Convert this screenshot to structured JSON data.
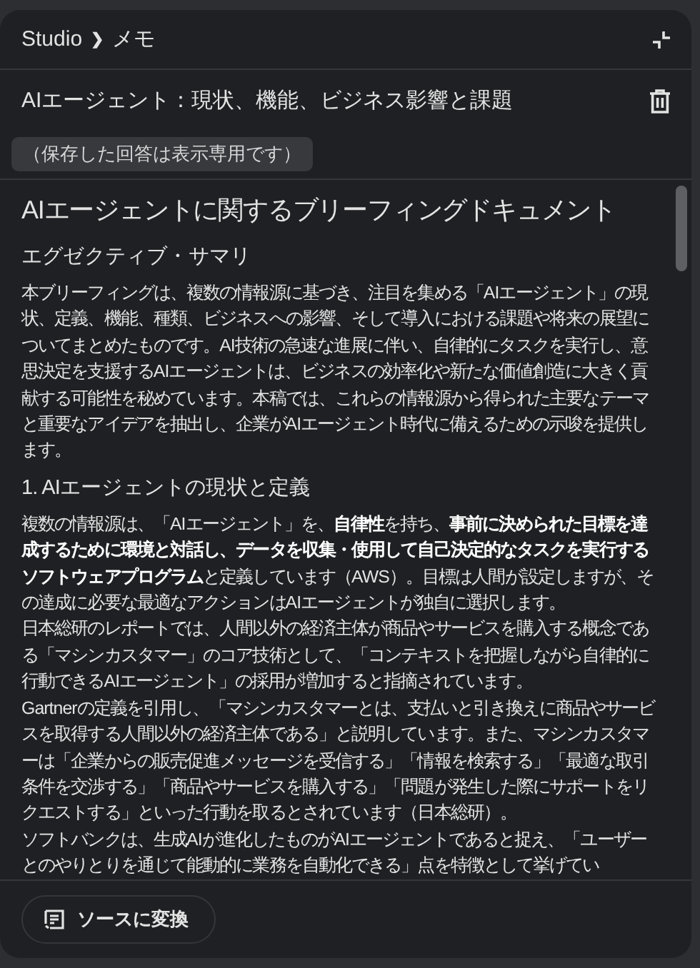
{
  "breadcrumb": {
    "root": "Studio",
    "separator": "❯",
    "current": "メモ"
  },
  "note": {
    "title": "AIエージェント：現状、機能、ビジネス影響と課題",
    "badge": "（保存した回答は表示専用です）"
  },
  "document": {
    "heading": "AIエージェントに関するブリーフィングドキュメント",
    "sections": [
      {
        "title": "エグゼクティブ・サマリ",
        "paragraphs": [
          "本ブリーフィングは、複数の情報源に基づき、注目を集める「AIエージェント」の現状、定義、機能、種類、ビジネスへの影響、そして導入における課題や将来の展望についてまとめたものです。AI技術の急速な進展に伴い、自律的にタスクを実行し、意思決定を支援するAIエージェントは、ビジネスの効率化や新たな価値創造に大きく貢献する可能性を秘めています。本稿では、これらの情報源から得られた主要なテーマと重要なアイデアを抽出し、企業がAIエージェント時代に備えるための示唆を提供します。"
        ]
      },
      {
        "title": "1. AIエージェントの現状と定義",
        "paragraphs": [
          "複数の情報源は、「AIエージェント」を、**自律性**を持ち、**事前に決められた目標を達成するために環境と対話し、データを収集・使用して自己決定的なタスクを実行するソフトウェアプログラム**と定義しています（AWS）。目標は人間が設定しますが、その達成に必要な最適なアクションはAIエージェントが独自に選択します。",
          "日本総研のレポートでは、人間以外の経済主体が商品やサービスを購入する概念である「マシンカスタマー」のコア技術として、「コンテキストを把握しながら自律的に行動できるAIエージェント」の採用が増加すると指摘されています。",
          "Gartnerの定義を引用し、「マシンカスタマーとは、支払いと引き換えに商品やサービスを取得する人間以外の経済主体である」と説明しています。また、マシンカスタマーは「企業からの販売促進メッセージを受信する」「情報を検索する」「最適な取引条件を交渉する」「商品やサービスを購入する」「問題が発生した際にサポートをリクエストする」といった行動を取るとされています（日本総研）。",
          "ソフトバンクは、生成AIが進化したものがAIエージェントであると捉え、「ユーザーとのやりとりを通じて能動的に業務を自動化できる」点を特徴として挙げてい"
        ]
      }
    ]
  },
  "footer": {
    "button": "ソースに変換"
  }
}
